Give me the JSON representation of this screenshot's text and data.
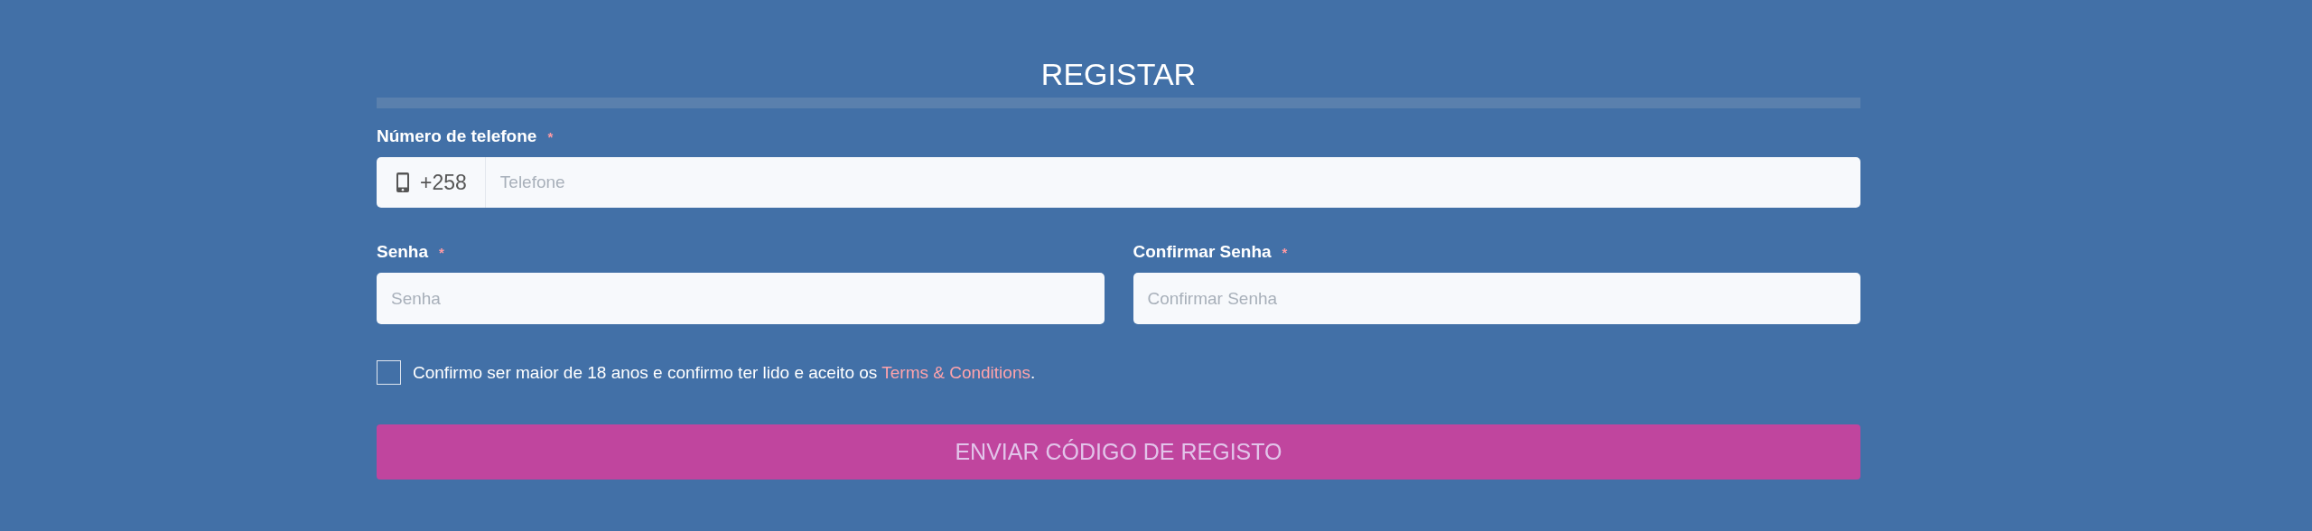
{
  "title": "REGISTAR",
  "phone": {
    "label": "Número de telefone",
    "required_mark": "*",
    "prefix": "+258",
    "placeholder": "Telefone"
  },
  "password_fields": [
    {
      "label": "Senha",
      "required_mark": "*",
      "placeholder": "Senha"
    },
    {
      "label": "Confirmar Senha",
      "required_mark": "*",
      "placeholder": "Confirmar Senha"
    }
  ],
  "consent": {
    "checked": false,
    "text": "Confirmo ser maior de 18 anos e confirmo ter lido e aceito os ",
    "link": "Terms & Conditions",
    "suffix": "."
  },
  "submit": {
    "label": "ENVIAR CÓDIGO DE REGISTO",
    "disabled": true
  }
}
